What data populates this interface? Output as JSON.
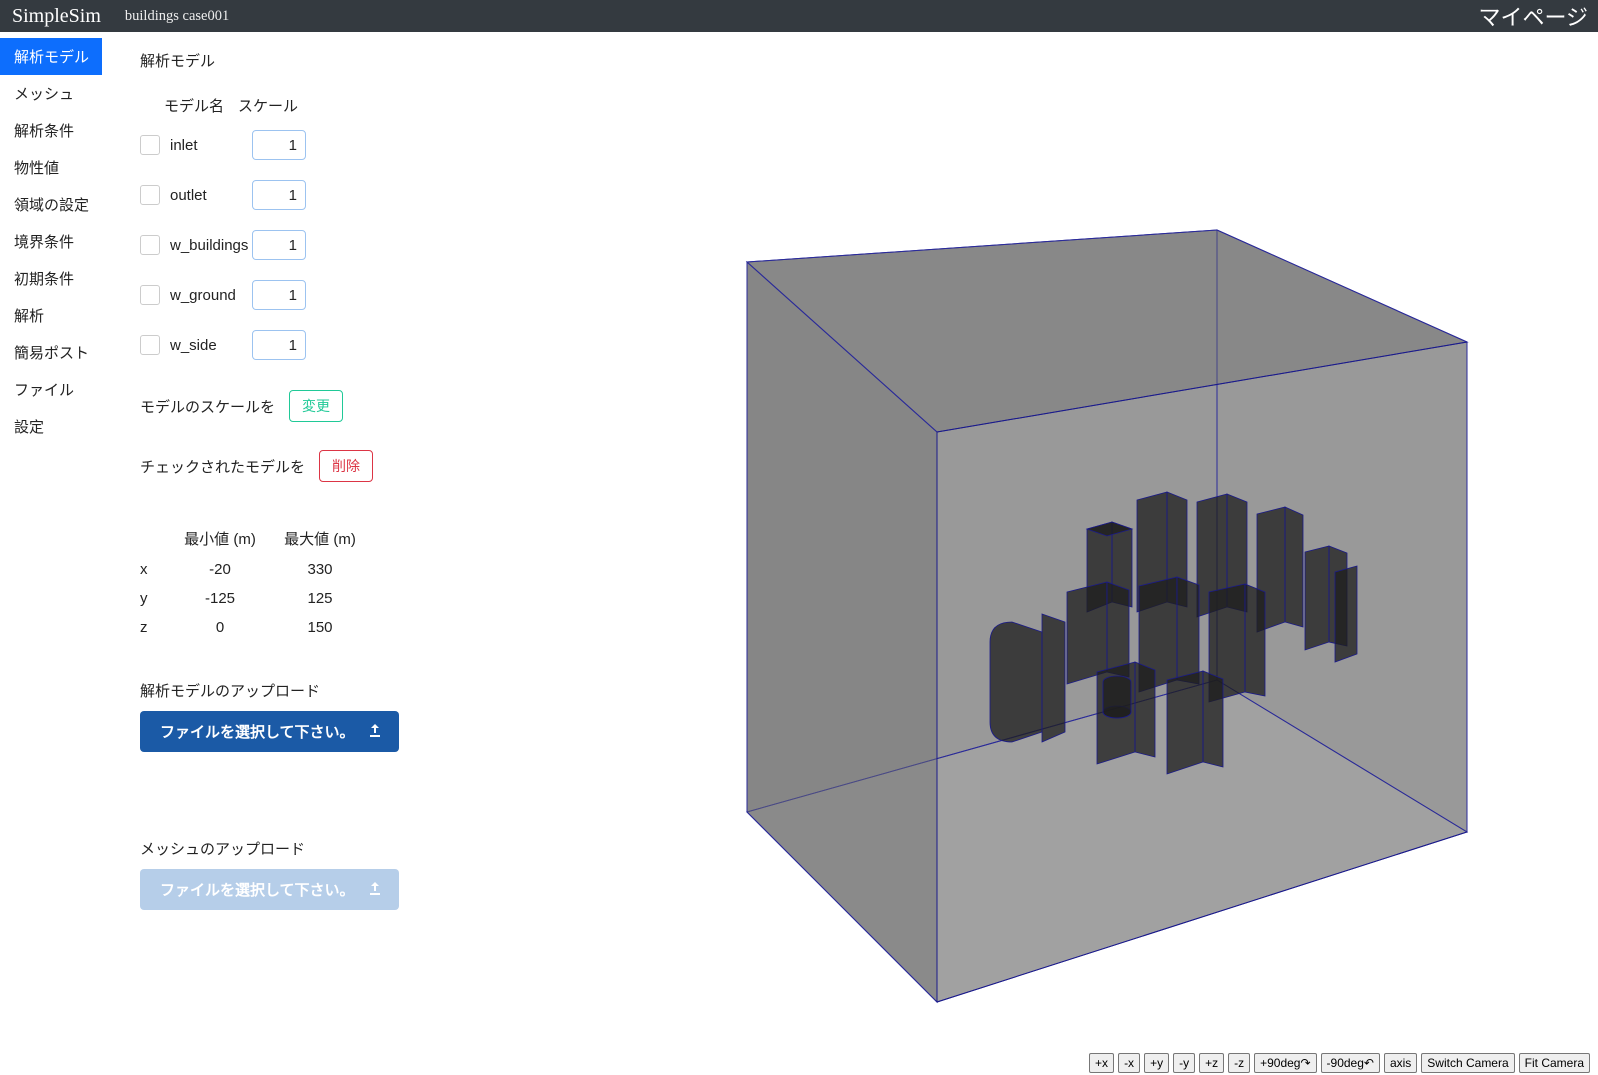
{
  "header": {
    "brand": "SimpleSim",
    "breadcrumb": "buildings case001",
    "mypage": "マイページ"
  },
  "sidebar": {
    "items": [
      {
        "label": "解析モデル",
        "active": true
      },
      {
        "label": "メッシュ",
        "active": false
      },
      {
        "label": "解析条件",
        "active": false
      },
      {
        "label": "物性値",
        "active": false
      },
      {
        "label": "領域の設定",
        "active": false
      },
      {
        "label": "境界条件",
        "active": false
      },
      {
        "label": "初期条件",
        "active": false
      },
      {
        "label": "解析",
        "active": false
      },
      {
        "label": "簡易ポスト",
        "active": false
      },
      {
        "label": "ファイル",
        "active": false
      },
      {
        "label": "設定",
        "active": false
      }
    ]
  },
  "panel": {
    "title": "解析モデル",
    "headers": {
      "model_name": "モデル名",
      "scale": "スケール"
    },
    "models": [
      {
        "name": "inlet",
        "scale": "1"
      },
      {
        "name": "outlet",
        "scale": "1"
      },
      {
        "name": "w_buildings",
        "scale": "1"
      },
      {
        "name": "w_ground",
        "scale": "1"
      },
      {
        "name": "w_side",
        "scale": "1"
      }
    ],
    "scale_change": {
      "text": "モデルのスケールを",
      "button": "変更"
    },
    "delete_checked": {
      "text": "チェックされたモデルを",
      "button": "削除"
    },
    "bounds": {
      "headers": {
        "min": "最小値 (m)",
        "max": "最大値 (m)"
      },
      "rows": [
        {
          "axis": "x",
          "min": "-20",
          "max": "330"
        },
        {
          "axis": "y",
          "min": "-125",
          "max": "125"
        },
        {
          "axis": "z",
          "min": "0",
          "max": "150"
        }
      ]
    },
    "upload_model": {
      "title": "解析モデルのアップロード",
      "button": "ファイルを選択して下さい。"
    },
    "upload_mesh": {
      "title": "メッシュのアップロード",
      "button": "ファイルを選択して下さい。"
    }
  },
  "viewport": {
    "controls": [
      "+x",
      "-x",
      "+y",
      "-y",
      "+z",
      "-z",
      "+90deg↷",
      "-90deg↶",
      "axis",
      "Switch Camera",
      "Fit Camera"
    ]
  }
}
